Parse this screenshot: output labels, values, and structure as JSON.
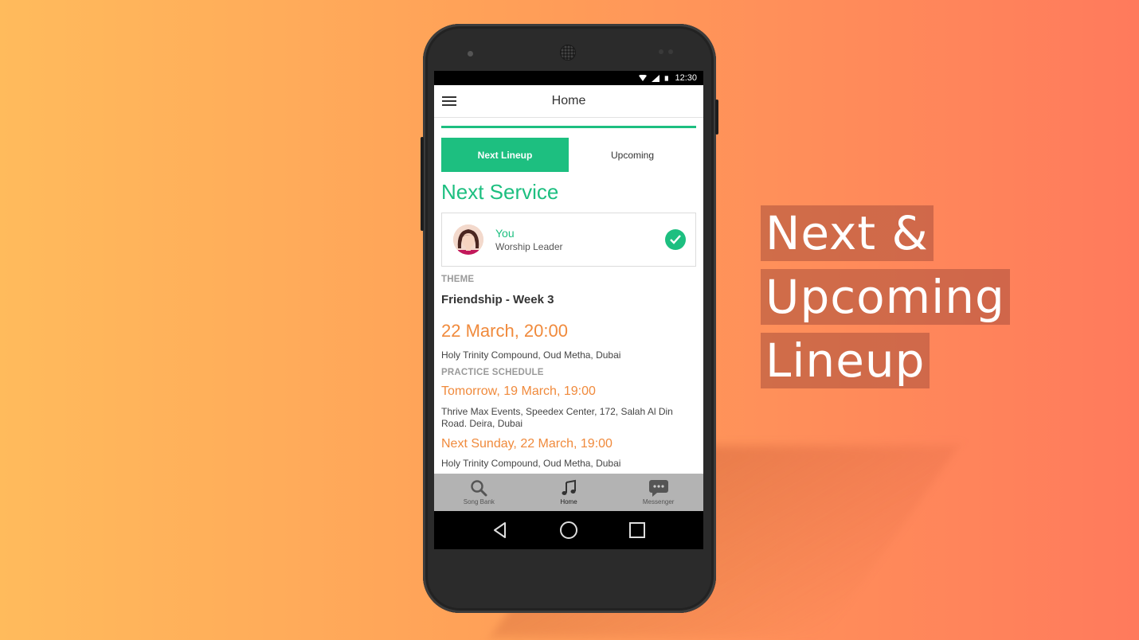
{
  "status_bar": {
    "time": "12:30"
  },
  "app_bar": {
    "title": "Home"
  },
  "tabs": [
    {
      "label": "Next Lineup",
      "active": true
    },
    {
      "label": "Upcoming",
      "active": false
    }
  ],
  "next_service": {
    "title": "Next Service",
    "member": {
      "name": "You",
      "role": "Worship Leader",
      "confirmed": true
    },
    "theme_label": "THEME",
    "theme": "Friendship - Week 3",
    "date": "22 March, 20:00",
    "location": "Holy Trinity Compound, Oud Metha, Dubai",
    "practice_label": "PRACTICE SCHEDULE",
    "practices": [
      {
        "date": "Tomorrow, 19 March, 19:00",
        "location": "Thrive Max Events, Speedex Center, 172, Salah Al Din Road. Deira, Dubai"
      },
      {
        "date": "Next Sunday, 22 March, 19:00",
        "location": "Holy Trinity Compound, Oud Metha, Dubai"
      }
    ]
  },
  "bottom_nav": [
    {
      "label": "Song Bank",
      "icon": "search-icon"
    },
    {
      "label": "Home",
      "icon": "music-note-icon",
      "active": true
    },
    {
      "label": "Messenger",
      "icon": "chat-bubble-icon"
    }
  ],
  "headline": {
    "line1": "Next &",
    "line2": "Upcoming",
    "line3": "Lineup"
  },
  "colors": {
    "accent": "#1dbf80",
    "date": "#f08a3c"
  }
}
